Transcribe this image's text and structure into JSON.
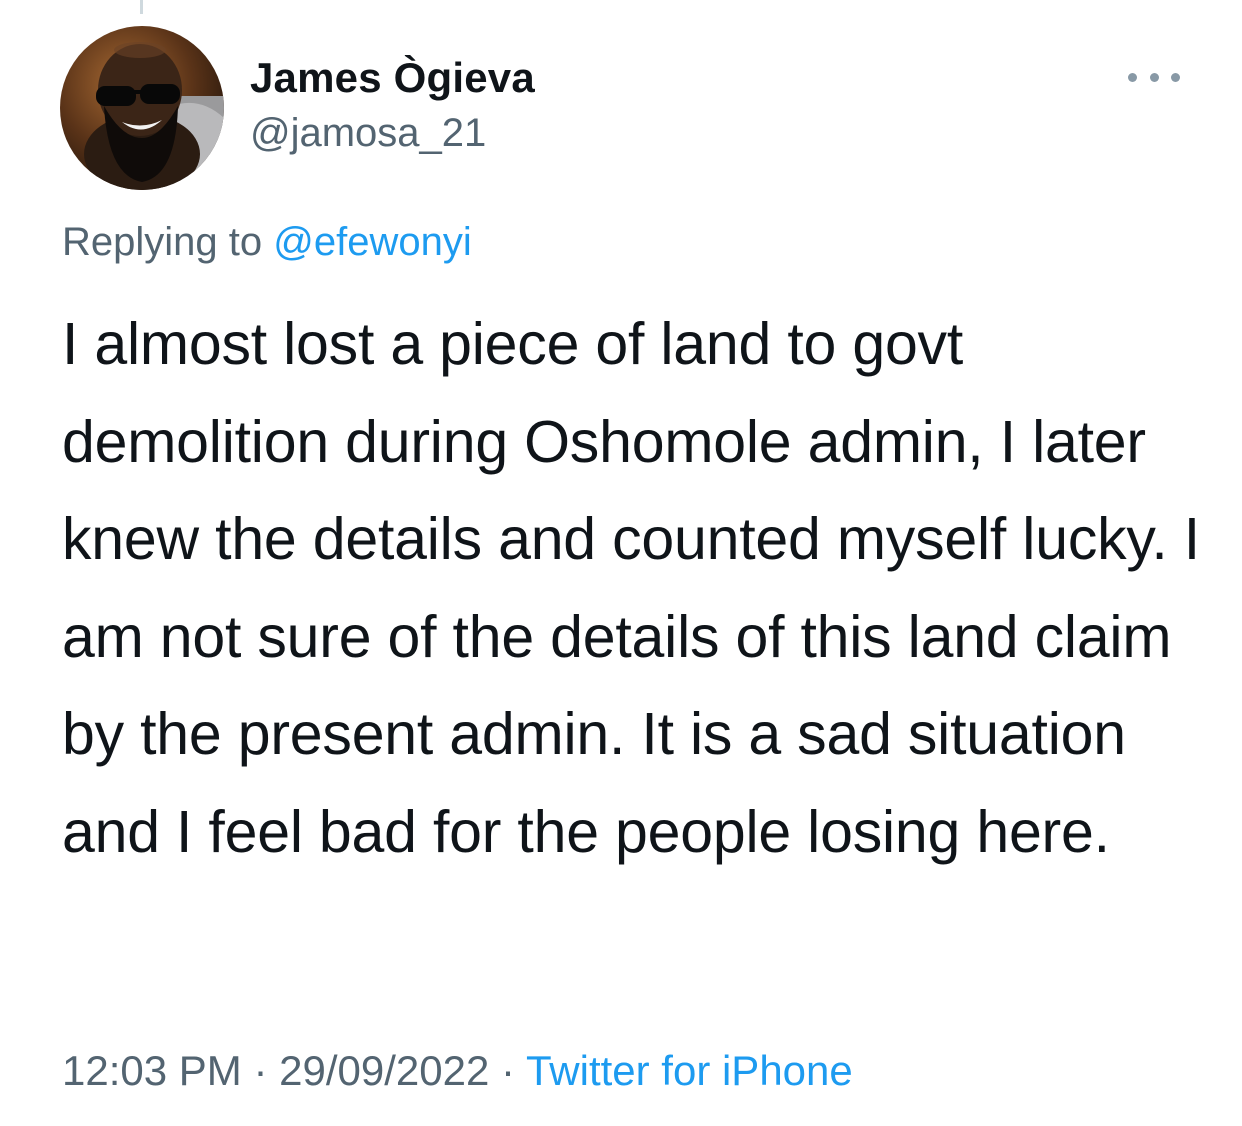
{
  "tweet": {
    "author": {
      "display_name": "James Ògieva",
      "handle": "@jamosa_21"
    },
    "replying_to_prefix": "Replying to",
    "replying_to_handle": "@efewonyi",
    "text": "I almost lost a piece of land to govt demolition during Oshomole admin, I later knew the details and counted myself lucky. I am not sure of the details of this land claim by the present admin. It is a sad situation and I feel bad for the people losing here.",
    "time": "12:03 PM",
    "date": "29/09/2022",
    "separator": "·",
    "source": "Twitter for iPhone"
  },
  "icons": {
    "avatar": "profile-photo",
    "menu": "more-horizontal-icon"
  },
  "colors": {
    "text_primary": "#0f1419",
    "text_secondary": "#536471",
    "link": "#1d9bf0",
    "icon_gray": "#8899a6"
  }
}
